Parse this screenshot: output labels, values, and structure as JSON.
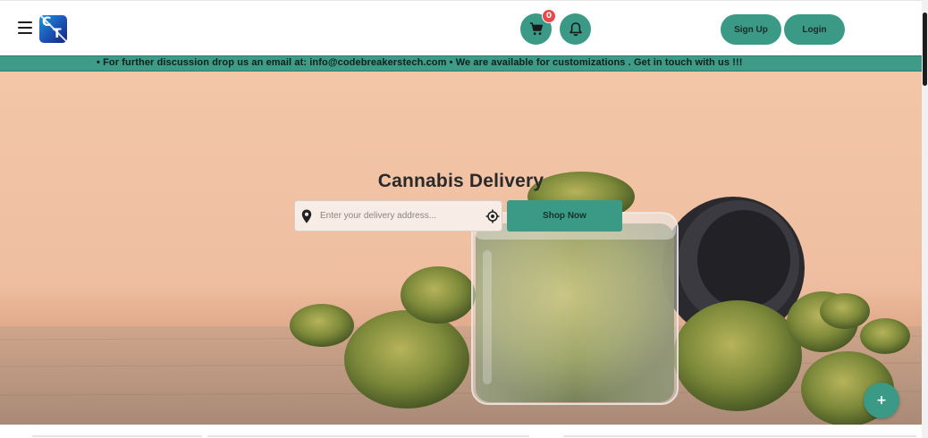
{
  "header": {
    "cart_count": "0",
    "signup_label": "Sign Up",
    "login_label": "Login",
    "logo_letters": {
      "top": "C",
      "bottom": "T"
    }
  },
  "banner": {
    "text": "• For further discussion drop us an email at: info@codebreakerstech.com • We are available for customizations . Get in touch with us !!!"
  },
  "hero": {
    "title": "Cannabis Delivery",
    "search_placeholder": "Enter your delivery address...",
    "shop_button": "Shop Now"
  },
  "fab": {
    "label": "+"
  },
  "icons": [
    "menu-icon",
    "cart-icon",
    "bell-icon",
    "map-pin-icon",
    "locate-icon",
    "plus-icon"
  ],
  "colors": {
    "accent": "#3a9a86",
    "badge": "#e84a4a",
    "hero_bg": "#f3c6a8"
  }
}
